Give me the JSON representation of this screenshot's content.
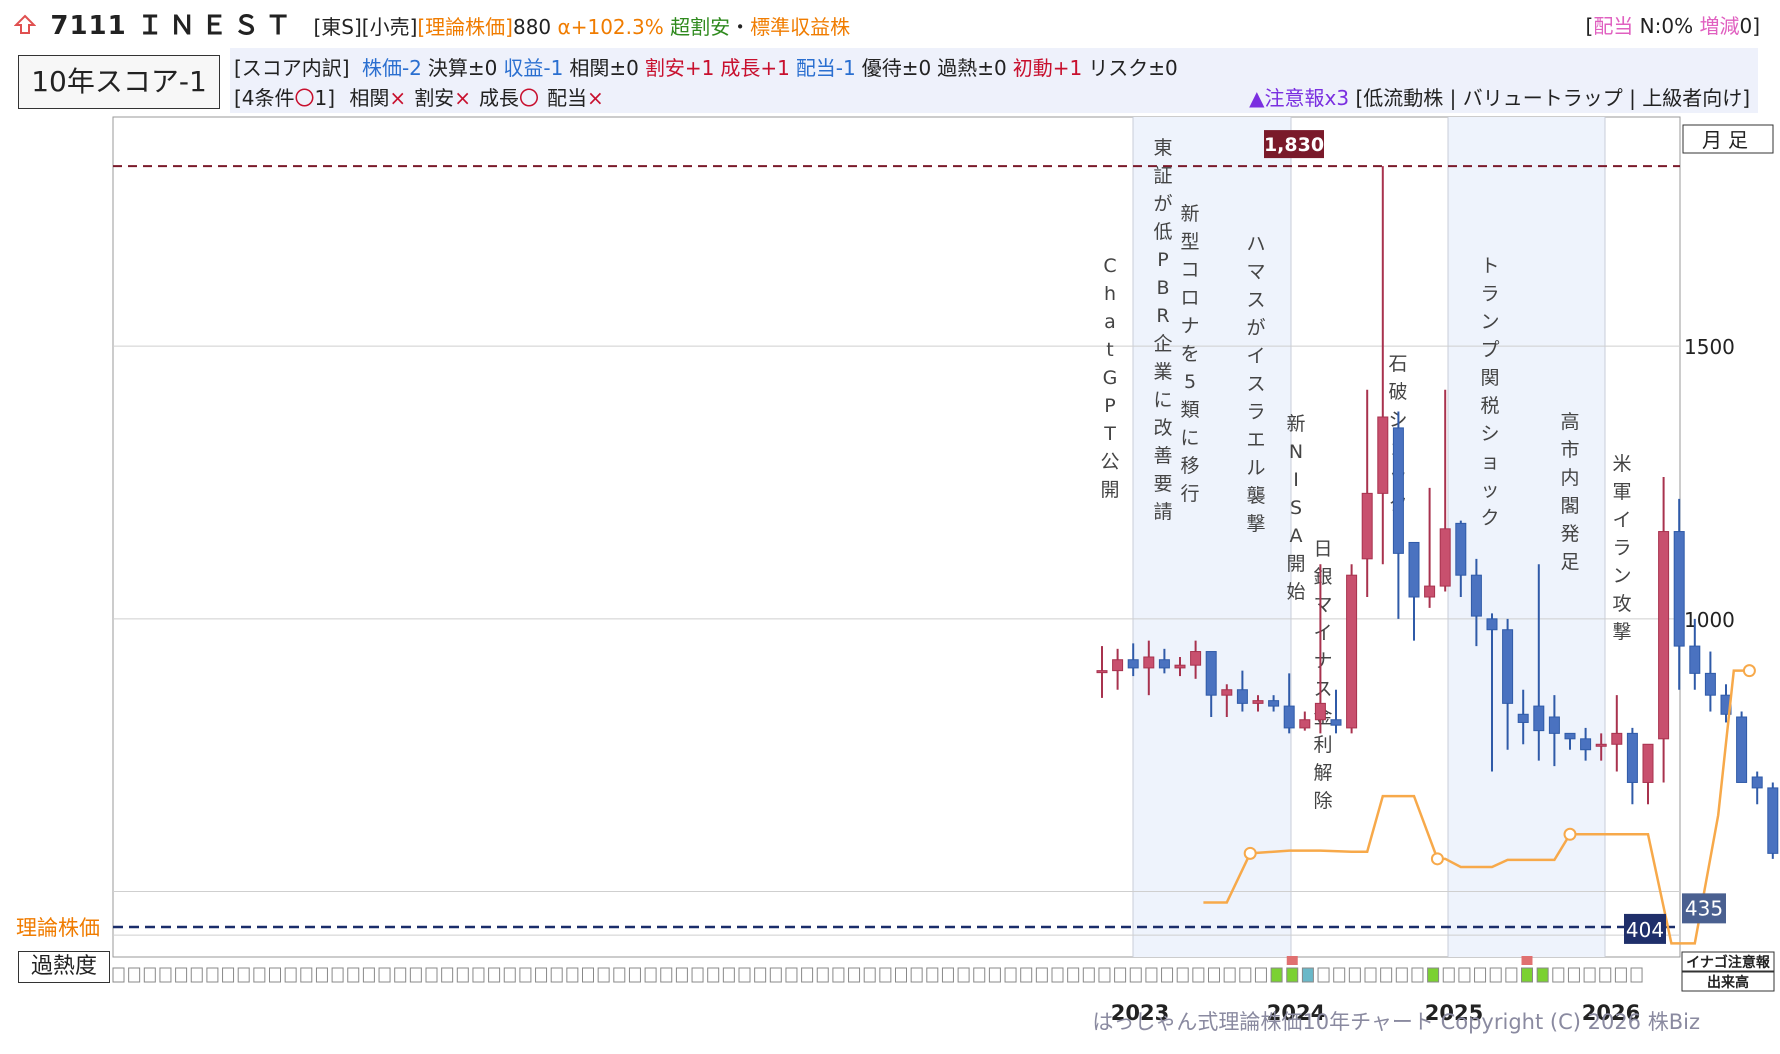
{
  "header": {
    "home_icon": "house-arrow-icon",
    "code": "7111",
    "name": "ＩＮＥＳＴ",
    "market": "[東S][小売]",
    "theory_label": "[理論株価]",
    "theory_value": "880",
    "alpha": "α+102.3%",
    "valuation_tag": "超割安",
    "separator": "・",
    "type_tag": "標準収益株",
    "dividend_prefix": "[",
    "dividend_label": "配当",
    "dividend_n": "N:0%",
    "dividend_change_label": "増減",
    "dividend_change_value": "0]"
  },
  "score": {
    "label": "10年スコア-1",
    "breakdown_prefix": "[スコア内訳]",
    "items": [
      {
        "text": "株価-2",
        "color": "#2a6fd0"
      },
      {
        "text": "決算±0",
        "color": "#222222"
      },
      {
        "text": "収益-1",
        "color": "#2a6fd0"
      },
      {
        "text": "相関±0",
        "color": "#222222"
      },
      {
        "text": "割安+1",
        "color": "#c8102e"
      },
      {
        "text": "成長+1",
        "color": "#c8102e"
      },
      {
        "text": "配当-1",
        "color": "#2a6fd0"
      },
      {
        "text": "優待±0",
        "color": "#222222"
      },
      {
        "text": "過熱±0",
        "color": "#222222"
      },
      {
        "text": "初動+1",
        "color": "#c8102e"
      },
      {
        "text": "リスク±0",
        "color": "#222222"
      }
    ],
    "conditions_prefix": "[4条件",
    "conditions_mark": "〇",
    "conditions_suffix": "1]",
    "conditions": [
      {
        "label": "相関",
        "mark": "×",
        "color": "#c8102e"
      },
      {
        "label": "割安",
        "mark": "×",
        "color": "#c8102e"
      },
      {
        "label": "成長",
        "mark": "〇",
        "color": "#c8102e"
      },
      {
        "label": "配当",
        "mark": "×",
        "color": "#c8102e"
      }
    ],
    "warning": "▲注意報x3",
    "warning_tags": "[低流動株 | バリュートラップ | 上級者向け]"
  },
  "chart_data": {
    "type": "candlestick",
    "timeframe": "月足",
    "y_ticks": [
      1500,
      1000
    ],
    "ylim": [
      380,
      1920
    ],
    "x_ticks": [
      "2023",
      "2024",
      "2025",
      "2026"
    ],
    "theory_price_label": "理論株価",
    "theory_price_level": 435,
    "max_label": "1,830",
    "max_price": 1830,
    "min_label": "404",
    "min_price": 404,
    "last_label": "435",
    "last_price": 471,
    "events": [
      "ChatGPT公開",
      "東証が低PBR企業に改善要請",
      "新型コロナを5類に移行",
      "ハマスがイスラエル襲撃",
      "新NISA開始",
      "日銀マイナス金利解除",
      "石破ショック",
      "トランプ関税ショック",
      "高市内閣発足",
      "米軍イラン攻撃"
    ],
    "candles": [
      {
        "o": 905,
        "h": 950,
        "l": 855,
        "c": 905
      },
      {
        "o": 905,
        "h": 945,
        "l": 870,
        "c": 925
      },
      {
        "o": 925,
        "h": 955,
        "l": 895,
        "c": 910
      },
      {
        "o": 910,
        "h": 960,
        "l": 860,
        "c": 930
      },
      {
        "o": 925,
        "h": 945,
        "l": 900,
        "c": 910
      },
      {
        "o": 910,
        "h": 930,
        "l": 895,
        "c": 915
      },
      {
        "o": 915,
        "h": 960,
        "l": 890,
        "c": 940
      },
      {
        "o": 940,
        "h": 940,
        "l": 820,
        "c": 860
      },
      {
        "o": 860,
        "h": 880,
        "l": 820,
        "c": 870
      },
      {
        "o": 870,
        "h": 905,
        "l": 830,
        "c": 845
      },
      {
        "o": 845,
        "h": 860,
        "l": 830,
        "c": 850
      },
      {
        "o": 850,
        "h": 860,
        "l": 830,
        "c": 840
      },
      {
        "o": 840,
        "h": 900,
        "l": 790,
        "c": 800
      },
      {
        "o": 800,
        "h": 830,
        "l": 795,
        "c": 815
      },
      {
        "o": 815,
        "h": 1100,
        "l": 790,
        "c": 845
      },
      {
        "o": 815,
        "h": 870,
        "l": 790,
        "c": 805
      },
      {
        "o": 800,
        "h": 1100,
        "l": 790,
        "c": 1080
      },
      {
        "o": 1110,
        "h": 1420,
        "l": 1040,
        "c": 1230
      },
      {
        "o": 1230,
        "h": 1830,
        "l": 1100,
        "c": 1370
      },
      {
        "o": 1350,
        "h": 1380,
        "l": 1000,
        "c": 1120
      },
      {
        "o": 1140,
        "h": 1050,
        "l": 960,
        "c": 1040
      },
      {
        "o": 1040,
        "h": 1240,
        "l": 1020,
        "c": 1060
      },
      {
        "o": 1060,
        "h": 1420,
        "l": 1050,
        "c": 1165
      },
      {
        "o": 1175,
        "h": 1180,
        "l": 1040,
        "c": 1080
      },
      {
        "o": 1080,
        "h": 1110,
        "l": 950,
        "c": 1005
      },
      {
        "o": 1000,
        "h": 1010,
        "l": 720,
        "c": 980
      },
      {
        "o": 980,
        "h": 1000,
        "l": 760,
        "c": 845
      },
      {
        "o": 825,
        "h": 870,
        "l": 770,
        "c": 810
      },
      {
        "o": 840,
        "h": 1100,
        "l": 740,
        "c": 795
      },
      {
        "o": 820,
        "h": 860,
        "l": 730,
        "c": 790
      },
      {
        "o": 790,
        "h": 780,
        "l": 760,
        "c": 780
      },
      {
        "o": 780,
        "h": 800,
        "l": 740,
        "c": 760
      },
      {
        "o": 770,
        "h": 790,
        "l": 740,
        "c": 770
      },
      {
        "o": 770,
        "h": 860,
        "l": 720,
        "c": 790
      },
      {
        "o": 790,
        "h": 800,
        "l": 660,
        "c": 700
      },
      {
        "o": 700,
        "h": 760,
        "l": 660,
        "c": 770
      },
      {
        "o": 780,
        "h": 1260,
        "l": 700,
        "c": 1160
      },
      {
        "o": 1160,
        "h": 1220,
        "l": 870,
        "c": 950
      },
      {
        "o": 950,
        "h": 1000,
        "l": 870,
        "c": 900
      },
      {
        "o": 900,
        "h": 940,
        "l": 830,
        "c": 860
      },
      {
        "o": 860,
        "h": 880,
        "l": 810,
        "c": 825
      },
      {
        "o": 820,
        "h": 830,
        "l": 700,
        "c": 700
      },
      {
        "o": 710,
        "h": 720,
        "l": 660,
        "c": 690
      },
      {
        "o": 690,
        "h": 700,
        "l": 560,
        "c": 570
      },
      {
        "o": 570,
        "h": 640,
        "l": 560,
        "c": 640
      },
      {
        "o": 640,
        "h": 640,
        "l": 540,
        "c": 560
      },
      {
        "o": 540,
        "h": 560,
        "l": 490,
        "c": 520
      },
      {
        "o": 520,
        "h": 525,
        "l": 500,
        "c": 515
      },
      {
        "o": 515,
        "h": 600,
        "l": 490,
        "c": 535
      },
      {
        "o": 525,
        "h": 530,
        "l": 480,
        "c": 488
      }
    ],
    "theory_line": [
      {
        "i": 6.5,
        "v": 480
      },
      {
        "i": 8,
        "v": 480
      },
      {
        "i": 9.5,
        "v": 570
      },
      {
        "i": 12,
        "v": 575
      },
      {
        "i": 14,
        "v": 575
      },
      {
        "i": 16,
        "v": 573
      },
      {
        "i": 17,
        "v": 573
      },
      {
        "i": 18,
        "v": 675
      },
      {
        "i": 19,
        "v": 675
      },
      {
        "i": 20,
        "v": 675
      },
      {
        "i": 21.5,
        "v": 560
      },
      {
        "i": 22,
        "v": 560
      },
      {
        "i": 23,
        "v": 545
      },
      {
        "i": 25,
        "v": 545
      },
      {
        "i": 26,
        "v": 558
      },
      {
        "i": 29,
        "v": 558
      },
      {
        "i": 30,
        "v": 605
      },
      {
        "i": 32,
        "v": 605
      },
      {
        "i": 34,
        "v": 605
      },
      {
        "i": 35,
        "v": 605
      },
      {
        "i": 36.5,
        "v": 405
      },
      {
        "i": 38,
        "v": 405
      },
      {
        "i": 39.5,
        "v": 640
      },
      {
        "i": 40.5,
        "v": 905
      },
      {
        "i": 41.5,
        "v": 905
      }
    ],
    "overheat_cells": 98,
    "overheat_marks": [
      {
        "index": 74,
        "color": "#7bd132"
      },
      {
        "index": 75,
        "color": "#7bd132"
      },
      {
        "index": 76,
        "color": "#6ab8c8"
      },
      {
        "index": 84,
        "color": "#7bd132"
      },
      {
        "index": 90,
        "color": "#7bd132"
      },
      {
        "index": 91,
        "color": "#7bd132"
      }
    ],
    "inago_marks": [
      75,
      90
    ],
    "side_labels": {
      "inago": "イナゴ注意報",
      "volume": "出来高"
    }
  },
  "overheat_label": "過熱度",
  "footer": "はっしゃん式理論株価10年チャート Copyright (C) 2026 株Biz"
}
